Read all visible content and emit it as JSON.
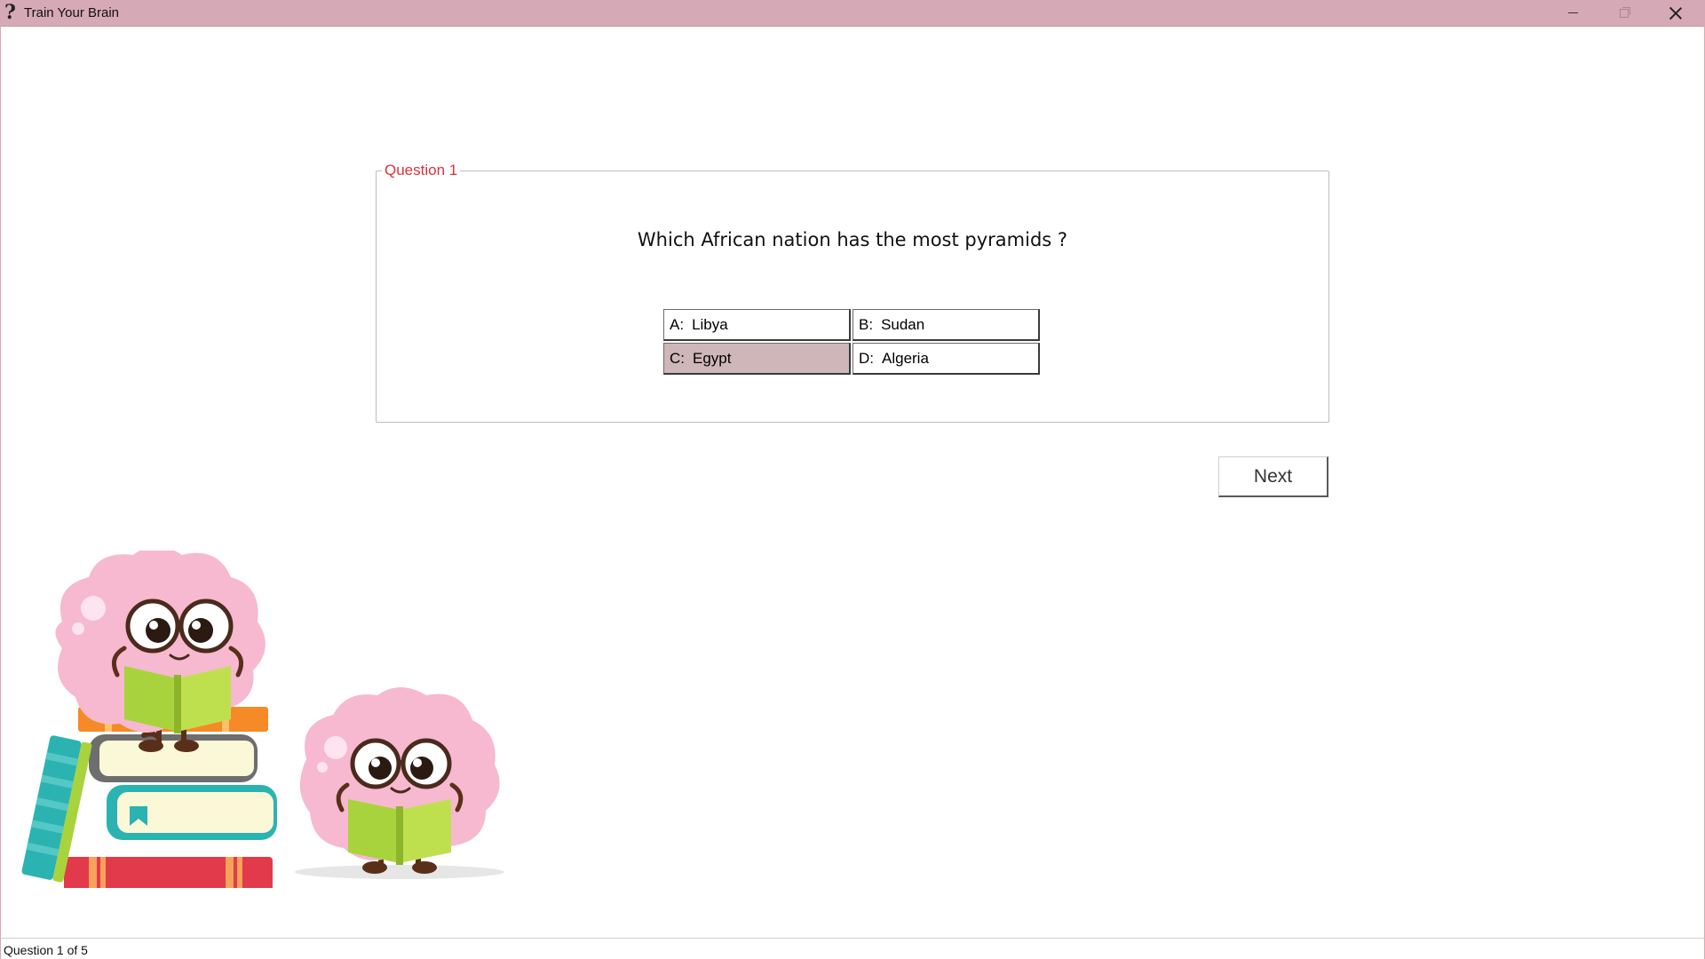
{
  "window": {
    "title": "Train Your Brain",
    "icon": "question-mark-icon",
    "icon_glyph": "?",
    "controls": [
      "minimize-icon",
      "maximize-icon",
      "close-icon"
    ]
  },
  "quiz": {
    "group_title": "Question 1",
    "question": "Which African nation has the most pyramids ?",
    "answers": [
      {
        "letter": "A:",
        "text": "Libya",
        "selected": false
      },
      {
        "letter": "B:",
        "text": "Sudan",
        "selected": false
      },
      {
        "letter": "C:",
        "text": "Egypt",
        "selected": true
      },
      {
        "letter": "D:",
        "text": "Algeria",
        "selected": false
      }
    ],
    "next_label": "Next"
  },
  "status": {
    "text": "Question 1 of 5"
  },
  "colors": {
    "titlebar": "#d6a9b6",
    "legend": "#e0313a",
    "selected_answer": "#cfb6b9",
    "brain_pink": "#f6b9cf",
    "book_green": "#a9d33c"
  },
  "illustration": {
    "description_icon": "brain-mascots-reading-books"
  }
}
